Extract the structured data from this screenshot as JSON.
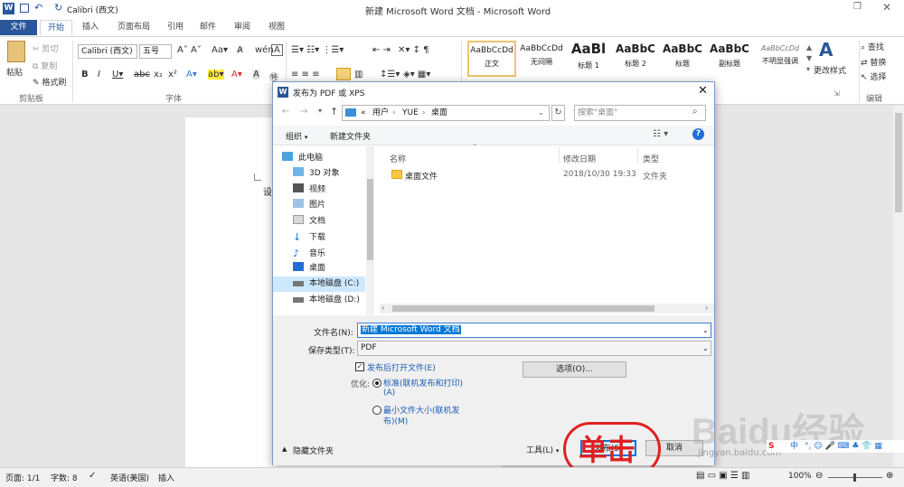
{
  "titlebar": {
    "font_name": "Calibri (西文)",
    "title": "新建 Microsoft Word 文档 - Microsoft Word"
  },
  "tabs": [
    "文件",
    "开始",
    "插入",
    "页面布局",
    "引用",
    "邮件",
    "审阅",
    "视图"
  ],
  "ribbon": {
    "clipboard": {
      "paste": "粘贴",
      "cut": "剪切",
      "copy": "复制",
      "format_painter": "格式刷",
      "group": "剪贴板"
    },
    "font": {
      "family": "Calibri (西文)",
      "size": "五号",
      "group": "字体"
    },
    "styles": [
      {
        "sample": "AaBbCcDd",
        "name": "正文"
      },
      {
        "sample": "AaBbCcDd",
        "name": "无间隔"
      },
      {
        "sample": "AaBl",
        "name": "标题 1"
      },
      {
        "sample": "AaBbC",
        "name": "标题 2"
      },
      {
        "sample": "AaBbC",
        "name": "标题"
      },
      {
        "sample": "AaBbC",
        "name": "副标题"
      },
      {
        "sample": "AaBbCcDd",
        "name": "不明显强调"
      }
    ],
    "change_styles": "更改样式",
    "editing": {
      "find": "查找",
      "replace": "替换",
      "select": "选择",
      "group": "编辑"
    }
  },
  "document": {
    "text": "设"
  },
  "dialog": {
    "title": "发布为 PDF 或 XPS",
    "path": [
      "«",
      "用户",
      "YUE",
      "桌面"
    ],
    "search_placeholder": "搜索\"桌面\"",
    "organize": "组织",
    "new_folder": "新建文件夹",
    "tree": [
      "此电脑",
      "3D 对象",
      "视频",
      "图片",
      "文档",
      "下载",
      "音乐",
      "桌面",
      "本地磁盘 (C:)",
      "本地磁盘 (D:)"
    ],
    "columns": {
      "name": "名称",
      "date": "修改日期",
      "type": "类型"
    },
    "files": [
      {
        "name": "桌面文件",
        "date": "2018/10/30 19:33",
        "type": "文件夹"
      }
    ],
    "filename_label": "文件名(N):",
    "filename_value": "新建 Microsoft Word 文档",
    "filetype_label": "保存类型(T):",
    "filetype_value": "PDF",
    "open_after_publish": "发布后打开文件(E)",
    "options_button": "选项(O)...",
    "optimize_label": "优化:",
    "optimize_standard": "标准(联机发布和打印)",
    "optimize_standard_key": "(A)",
    "optimize_minimum": "最小文件大小(联机发",
    "optimize_minimum_2": "布)(M)",
    "hide_folders": "隐藏文件夹",
    "tools": "工具(L)",
    "publish": "发布(S)",
    "cancel": "取消",
    "annotation": "单击"
  },
  "status": {
    "page": "页面: 1/1",
    "words": "字数: 8",
    "language": "英语(美国)",
    "insert": "插入",
    "zoom": "100%"
  },
  "watermark": {
    "text": "Baidu经验",
    "url": "jingyan.baidu.com"
  },
  "ime": {
    "lang": "中"
  },
  "colors": {
    "word_blue": "#2b579a",
    "dialog_border": "#7a9cc7",
    "annotation_red": "#e02020",
    "selection": "#0078d7"
  }
}
